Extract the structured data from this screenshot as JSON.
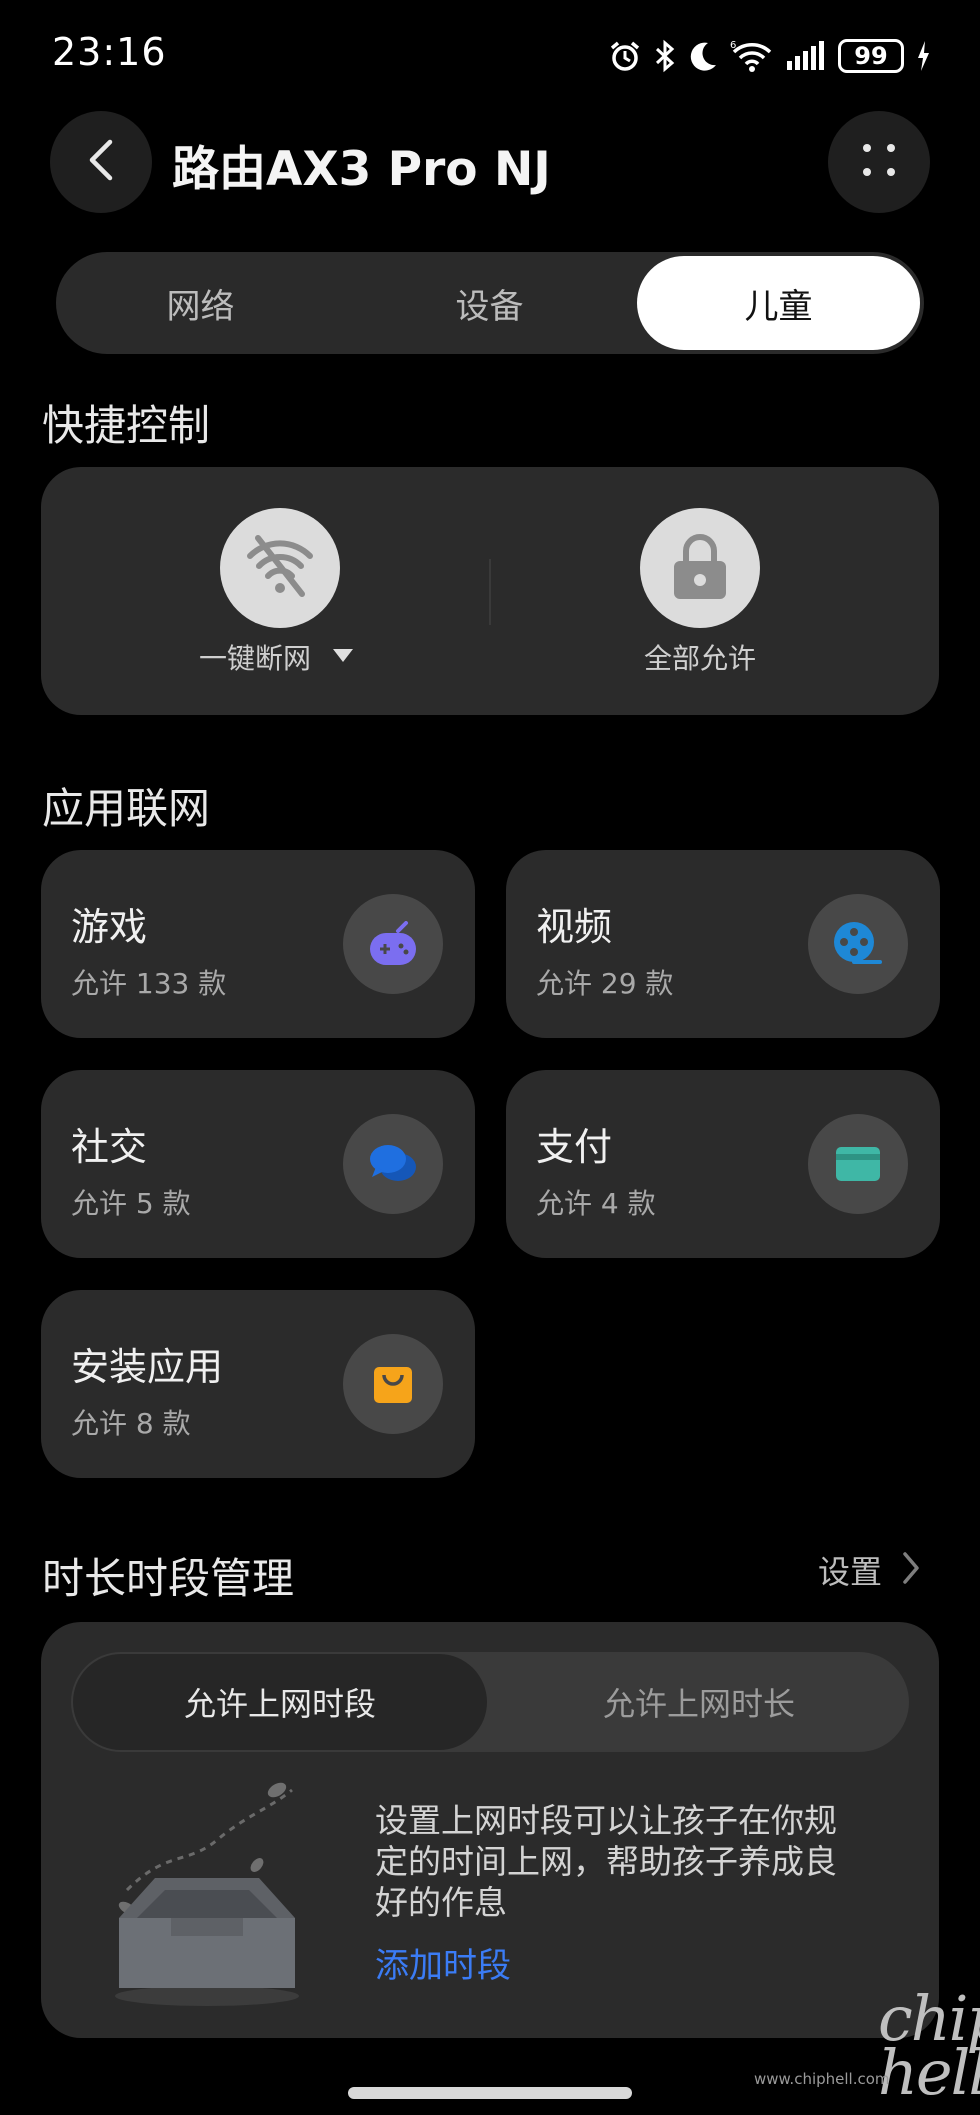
{
  "status_bar": {
    "time": "23:16",
    "battery": "99"
  },
  "header": {
    "title": "路由AX3 Pro NJ"
  },
  "tabs": [
    {
      "label": "网络",
      "active": false
    },
    {
      "label": "设备",
      "active": false
    },
    {
      "label": "儿童",
      "active": true
    }
  ],
  "quick_control": {
    "title": "快捷控制",
    "disconnect": {
      "label": "一键断网",
      "icon": "wifi-off-icon"
    },
    "allow_all": {
      "label": "全部允许",
      "icon": "lock-icon"
    }
  },
  "app_network": {
    "title": "应用联网",
    "items": [
      {
        "title": "游戏",
        "sub": "允许 133 款",
        "icon": "gamepad-icon",
        "color": "#7b6ef0"
      },
      {
        "title": "视频",
        "sub": "允许 29 款",
        "icon": "film-reel-icon",
        "color": "#1e88d6"
      },
      {
        "title": "社交",
        "sub": "允许 5 款",
        "icon": "chat-bubbles-icon",
        "color": "#1f6fe0"
      },
      {
        "title": "支付",
        "sub": "允许 4 款",
        "icon": "card-icon",
        "color": "#3fb7a6"
      },
      {
        "title": "安装应用",
        "sub": "允许 8 款",
        "icon": "shopping-bag-icon",
        "color": "#f6a41a"
      }
    ]
  },
  "time_management": {
    "title": "时长时段管理",
    "settings_link": "设置",
    "segments": {
      "active": "允许上网时段",
      "inactive": "允许上网时长"
    },
    "description_lines": [
      "设置上网时段可以让孩子在你规",
      "定的时间上网，帮助孩子养成良",
      "好的作息"
    ],
    "add_link": "添加时段"
  },
  "watermark": {
    "logo": "chip hell",
    "url": "www.chiphell.com"
  }
}
